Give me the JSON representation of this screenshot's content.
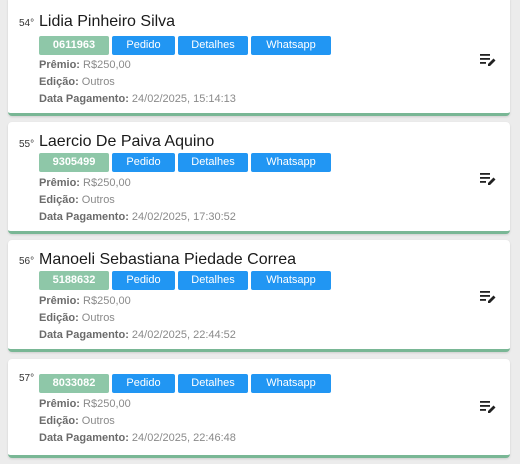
{
  "labels": {
    "premio": "Prêmio:",
    "edicao": "Edição:",
    "data_pagamento": "Data Pagamento:"
  },
  "buttons": {
    "pedido": "Pedido",
    "detalhes": "Detalhes",
    "whatsapp": "Whatsapp"
  },
  "icons": {
    "edit": "edit-note-icon"
  },
  "colors": {
    "code_badge": "#8ec7a8",
    "action_button": "#2196f3",
    "card_border": "#79b795"
  },
  "entries": [
    {
      "position": "54°",
      "name": "Lidia Pinheiro Silva",
      "code": "0611963",
      "premio": "R$250,00",
      "edicao": "Outros",
      "data_pagamento": "24/02/2025, 15:14:13"
    },
    {
      "position": "55°",
      "name": "Laercio De Paiva Aquino",
      "code": "9305499",
      "premio": "R$250,00",
      "edicao": "Outros",
      "data_pagamento": "24/02/2025, 17:30:52"
    },
    {
      "position": "56°",
      "name": "Manoeli Sebastiana Piedade Correa",
      "code": "5188632",
      "premio": "R$250,00",
      "edicao": "Outros",
      "data_pagamento": "24/02/2025, 22:44:52"
    },
    {
      "position": "57°",
      "name": "",
      "code": "8033082",
      "premio": "R$250,00",
      "edicao": "Outros",
      "data_pagamento": "24/02/2025, 22:46:48"
    }
  ]
}
